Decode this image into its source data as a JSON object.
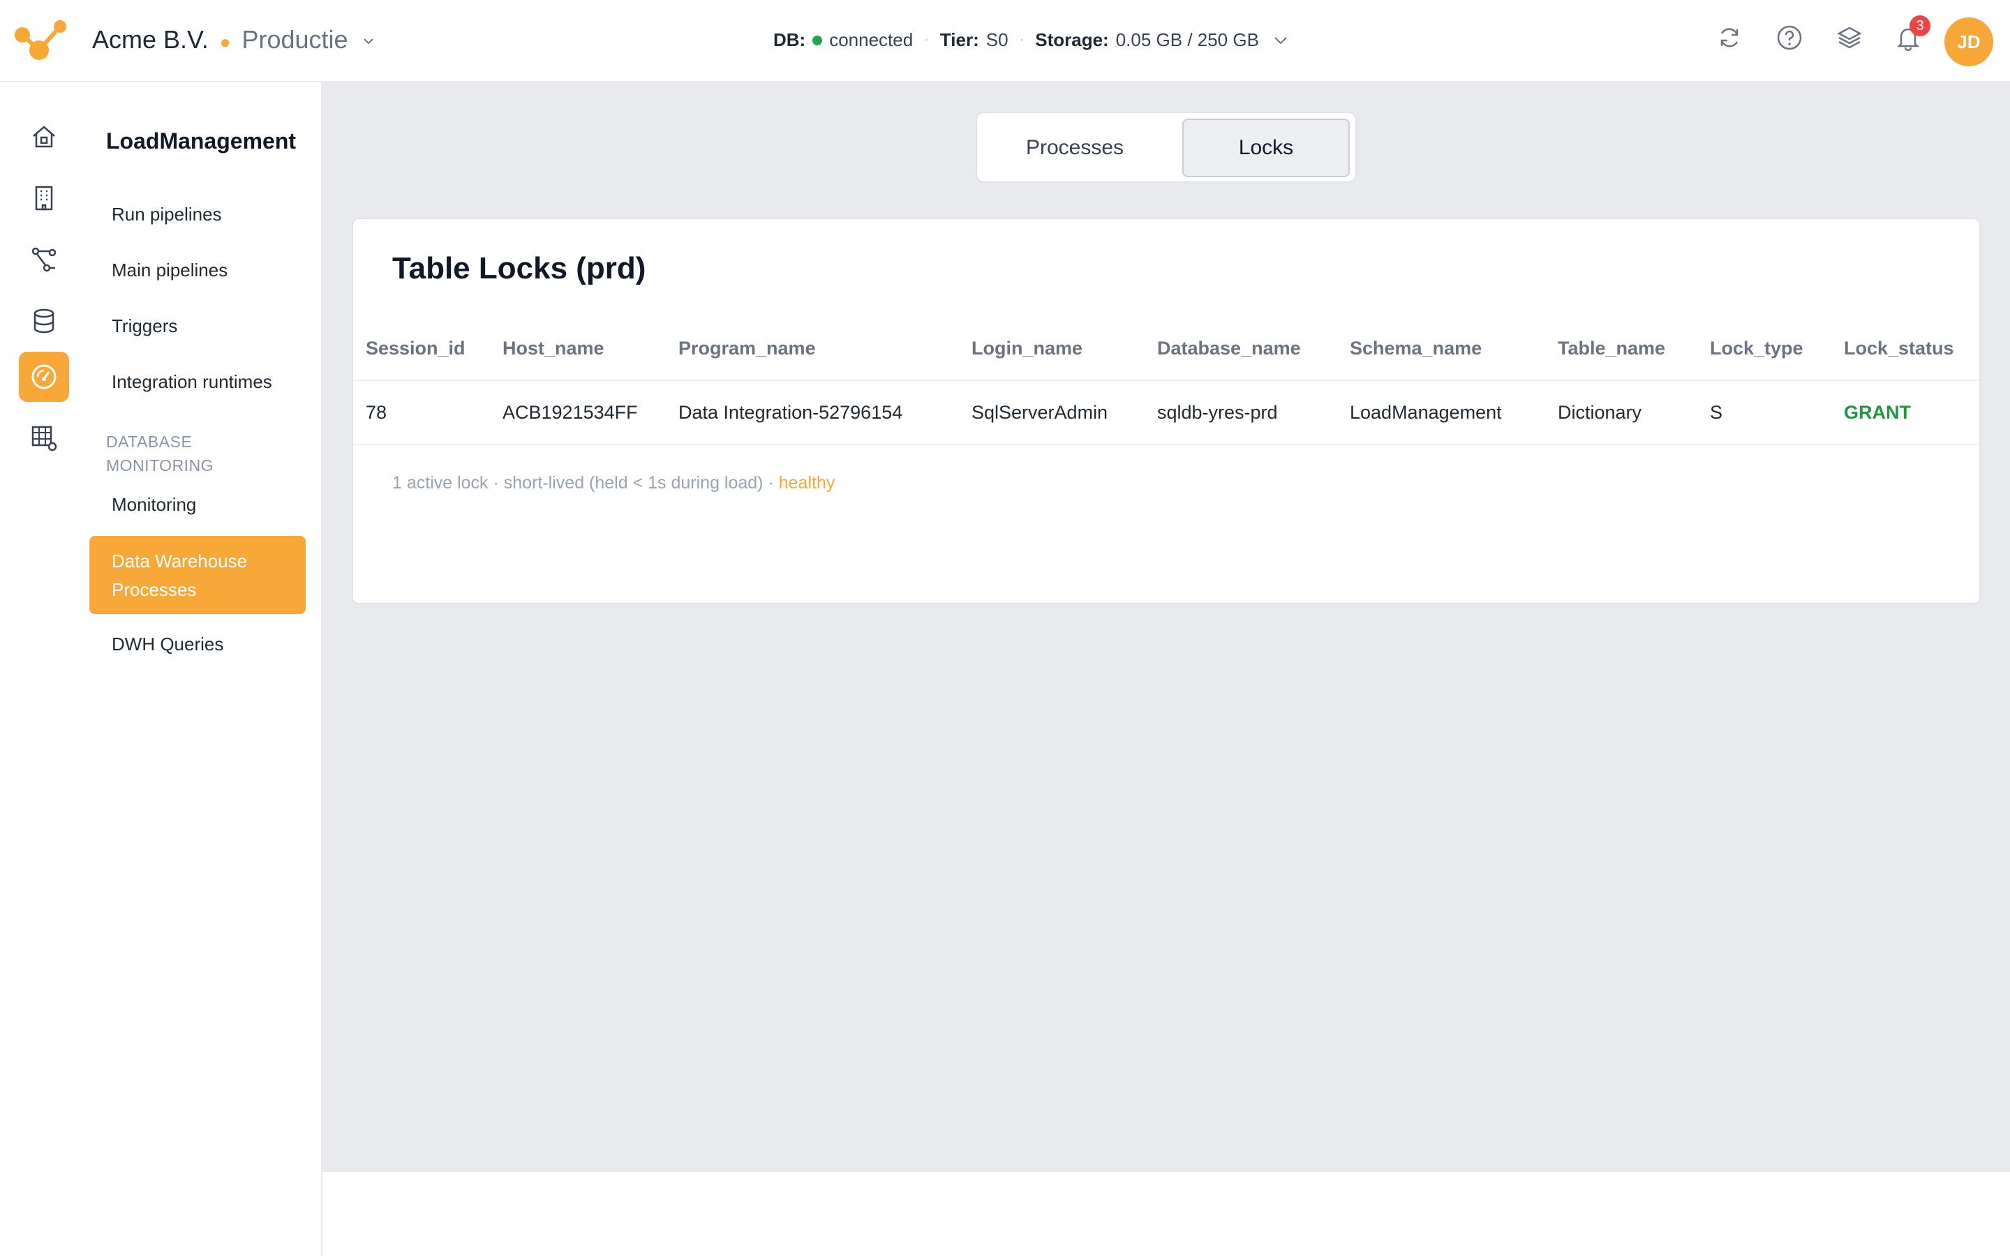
{
  "header": {
    "company": "Acme B.V.",
    "environment": "Productie",
    "db_label": "DB:",
    "db_status": "connected",
    "tier_label": "Tier:",
    "tier_value": "S0",
    "storage_label": "Storage:",
    "storage_value": "0.05 GB / 250 GB",
    "notification_count": "3",
    "user_initials": "JD"
  },
  "rail": {
    "icons": [
      "home-icon",
      "building-icon",
      "pipeline-icon",
      "database-icon",
      "speedometer-icon",
      "table-settings-icon"
    ],
    "active_index": 4
  },
  "sidenav": {
    "title": "LoadManagement",
    "items": [
      "Run pipelines",
      "Main pipelines",
      "Triggers",
      "Integration runtimes"
    ],
    "section": "DATABASE MONITORING",
    "section_items": [
      "Monitoring",
      "Data Warehouse Processes",
      "DWH Queries"
    ],
    "active_item": "Data Warehouse Processes"
  },
  "tabs": [
    {
      "label": "Processes",
      "active": false
    },
    {
      "label": "Locks",
      "active": true
    }
  ],
  "locks": {
    "title": "Table Locks (prd)",
    "columns": [
      "Session_id",
      "Host_name",
      "Program_name",
      "Login_name",
      "Database_name",
      "Schema_name",
      "Table_name",
      "Lock_type",
      "Lock_status"
    ],
    "rows": [
      [
        "78",
        "ACB1921534FF",
        "Data Integration-52796154",
        "SqlServerAdmin",
        "sqldb-yres-prd",
        "LoadManagement",
        "Dictionary",
        "S",
        "GRANT"
      ]
    ],
    "footnote": "1 active lock · short-lived (held < 1s during load) ·",
    "health": "healthy"
  },
  "colors": {
    "accent": "#f7a838",
    "status_connected": "#22a552",
    "grant": "#22963f",
    "badge": "#ef4444"
  }
}
